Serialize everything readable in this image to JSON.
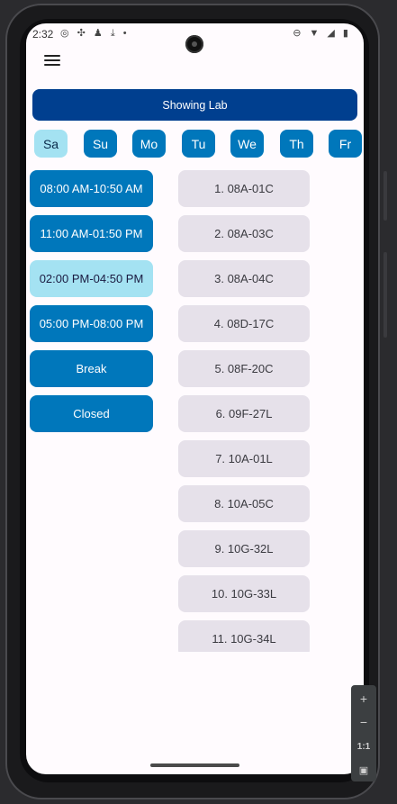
{
  "status": {
    "time": "2:32"
  },
  "header": {
    "banner": "Showing Lab"
  },
  "days": [
    {
      "label": "Sa",
      "selected": true
    },
    {
      "label": "Su",
      "selected": false
    },
    {
      "label": "Mo",
      "selected": false
    },
    {
      "label": "Tu",
      "selected": false
    },
    {
      "label": "We",
      "selected": false
    },
    {
      "label": "Th",
      "selected": false
    },
    {
      "label": "Fr",
      "selected": false
    }
  ],
  "time_slots": [
    {
      "label": "08:00 AM-10:50 AM",
      "selected": false
    },
    {
      "label": "11:00 AM-01:50 PM",
      "selected": false
    },
    {
      "label": "02:00 PM-04:50 PM",
      "selected": true
    },
    {
      "label": "05:00 PM-08:00 PM",
      "selected": false
    },
    {
      "label": "Break",
      "selected": false
    },
    {
      "label": "Closed",
      "selected": false
    }
  ],
  "labs": [
    "1. 08A-01C",
    "2. 08A-03C",
    "3. 08A-04C",
    "4. 08D-17C",
    "5. 08F-20C",
    "6. 09F-27L",
    "7. 10A-01L",
    "8. 10A-05C",
    "9. 10G-32L",
    "10. 10G-33L",
    "11. 10G-34L"
  ],
  "emulator_toolbar": {
    "zoom_in": "+",
    "zoom_out": "−",
    "actual_size": "1:1"
  },
  "colors": {
    "primary": "#003f8f",
    "button": "#0077bb",
    "selected": "#a4e2f2",
    "lab_item": "#e6e1ea"
  }
}
